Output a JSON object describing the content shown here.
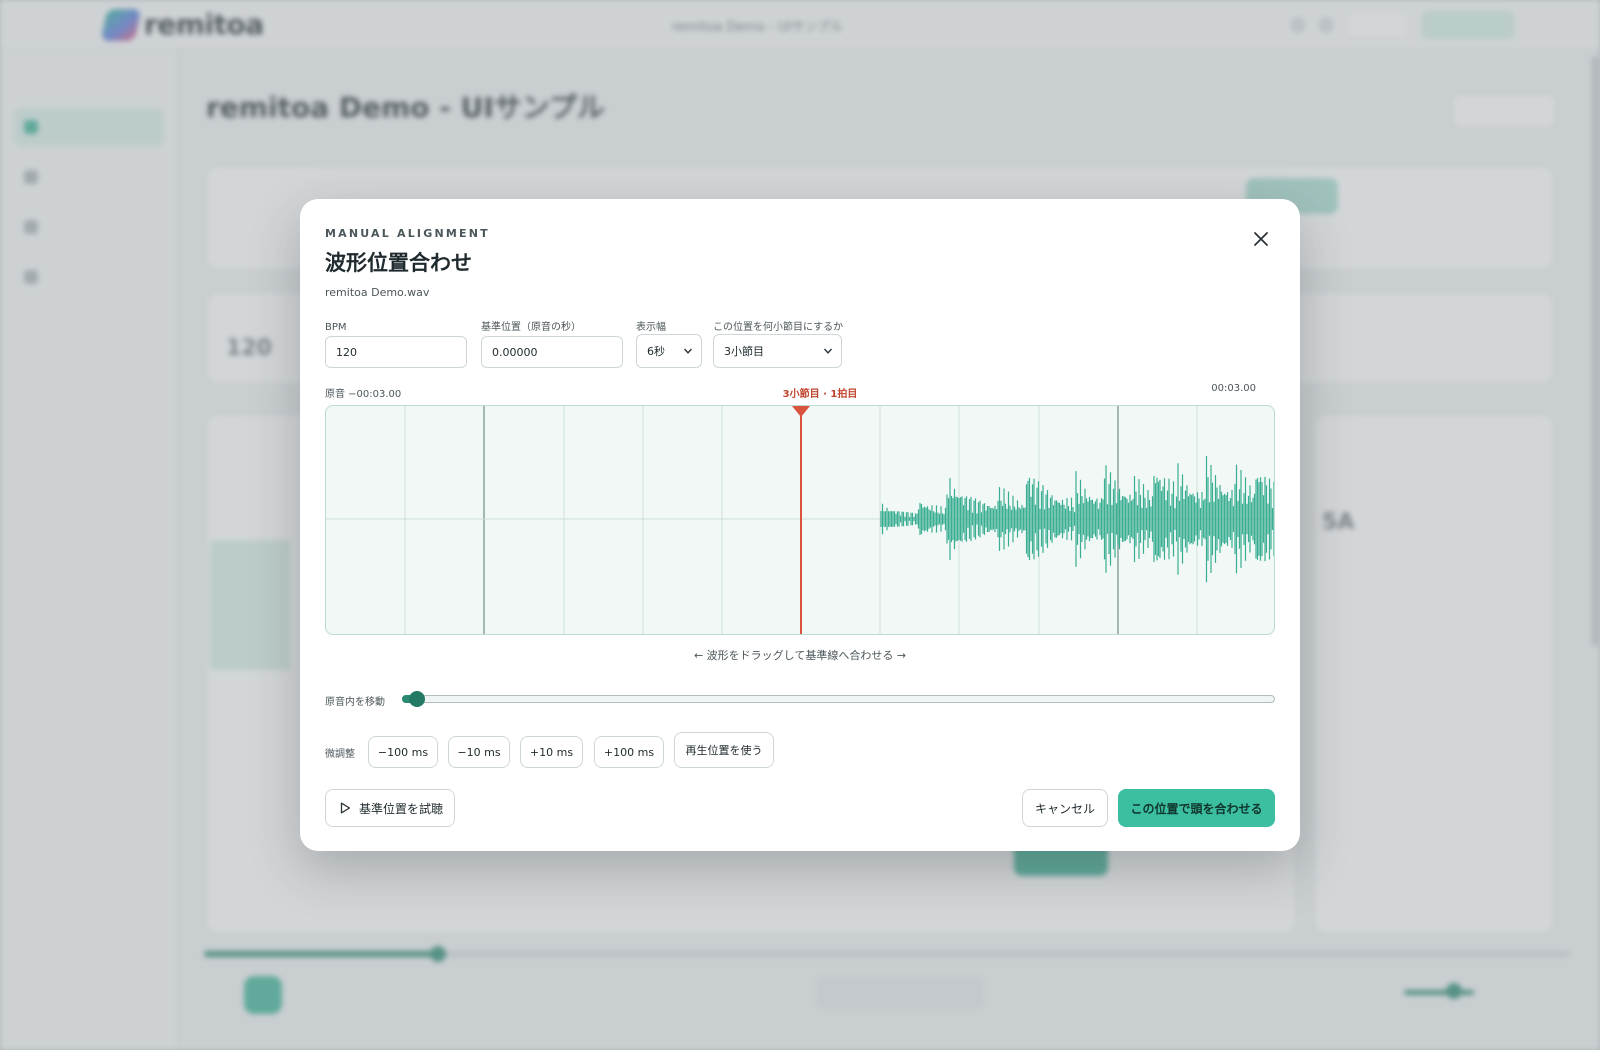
{
  "background": {
    "brand": "remitoa",
    "window_title": "remitoa Demo - UIサンプル",
    "page_title": "remitoa Demo - UIサンプル",
    "bpm_value": "120",
    "key_value": "5A"
  },
  "dialog": {
    "eyebrow": "MANUAL ALIGNMENT",
    "title": "波形位置合わせ",
    "filename": "remitoa Demo.wav",
    "fields": {
      "bpm_label": "BPM",
      "bpm_value": "120",
      "base_label": "基準位置（原音の秒）",
      "base_value": "0.00000",
      "width_label": "表示幅",
      "width_value": "6秒",
      "bar_label": "この位置を何小節目にするか",
      "bar_value": "3小節目"
    },
    "waveform": {
      "left_label": "原音 −00:03.00",
      "center_label": "3小節目 · 1拍目",
      "right_label": "00:03.00",
      "hint": "← 波形をドラッグして基準線へ合わせる →",
      "color": "#3aae92",
      "marker_color": "#d9533f"
    },
    "move": {
      "label": "原音内を移動",
      "value": 0.01
    },
    "fine": {
      "label": "微調整",
      "buttons": [
        "−100 ms",
        "−10 ms",
        "+10 ms",
        "+100 ms"
      ],
      "use_playhead": "再生位置を使う"
    },
    "actions": {
      "preview": "基準位置を試聴",
      "cancel": "キャンセル",
      "apply": "この位置で頭を合わせる"
    },
    "accent": "#3bbfa0"
  }
}
